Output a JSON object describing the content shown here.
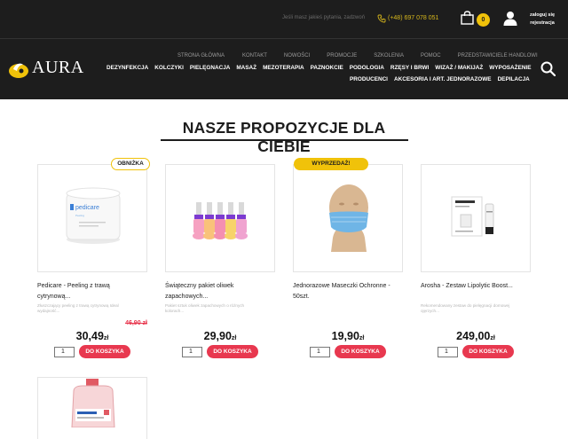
{
  "header": {
    "question_text": "Jeśli masz jakieś pytania, zadzwoń",
    "phone": "(+48) 697 078 051",
    "cart_count": "0",
    "login_line1": "zaloguj się",
    "login_line2": "rejestracja",
    "logo_text": "AURA",
    "colors": {
      "bar": "#1d1d1d",
      "accent": "#f0c20a",
      "button": "#e8384f"
    }
  },
  "nav_top": [
    "STRONA GŁÓWNA",
    "KONTAKT",
    "NOWOŚCI",
    "PROMOCJE",
    "SZKOLENIA",
    "POMOC",
    "PRZEDSTAWICIELE HANDLOWI"
  ],
  "nav_main": [
    "DEZYNFEKCJA",
    "KOLCZYKI",
    "PIELĘGNACJA",
    "MASAŻ",
    "MEZOTERAPIA",
    "PAZNOKCIE",
    "PODOLOGIA",
    "RZĘSY I BRWI",
    "WIZAŻ / MAKIJAŻ",
    "WYPOSAŻENIE"
  ],
  "nav_main2": [
    "PRODUCENCI",
    "AKCESORIA I ART. JEDNORAZOWE",
    "DEPILACJA"
  ],
  "section": {
    "title": "NASZE PROPOZYCJE DLA CIEBIE"
  },
  "products": [
    {
      "badge": "OBNIŻKA",
      "name_line1": "Pedicare - Peeling z trawą",
      "name_line2": "cytrynową...",
      "desc_line1": "Złuszczający peeling z trawą cytrynową Ideal",
      "desc_line2": "wydajność...",
      "old_price": "46,90 zł",
      "price": "30,49",
      "currency": "zł",
      "qty": "1",
      "button": "DO KOSZYKA",
      "image": "cream-jar-icon"
    },
    {
      "badge": "",
      "name_line1": "Świąteczny pakiet oliwek",
      "name_line2": "zapachowych...",
      "desc_line1": "Pakiet sztuk oliwek zapachowych o różnych",
      "desc_line2": "kolorach...",
      "old_price": "",
      "price": "29,90",
      "currency": "zł",
      "qty": "1",
      "button": "DO KOSZYKA",
      "image": "nail-oil-bottles-icon"
    },
    {
      "badge": "WYPRZEDAŻ!",
      "name_line1": "Jednorazowe Maseczki Ochronne -",
      "name_line2": "50szt.",
      "desc_line1": "",
      "desc_line2": "",
      "old_price": "",
      "price": "19,90",
      "currency": "zł",
      "qty": "1",
      "button": "DO KOSZYKA",
      "image": "face-mask-icon"
    },
    {
      "badge": "",
      "name_line1": "Arosha - Zestaw Lipolytic Boost...",
      "name_line2": "",
      "desc_line1": "Rekomendowany zestaw do pielęgnacji domowej",
      "desc_line2": "ojęrzych...",
      "old_price": "",
      "price": "249,00",
      "currency": "zł",
      "qty": "1",
      "button": "DO KOSZYKA",
      "image": "cosmetic-set-icon"
    }
  ]
}
